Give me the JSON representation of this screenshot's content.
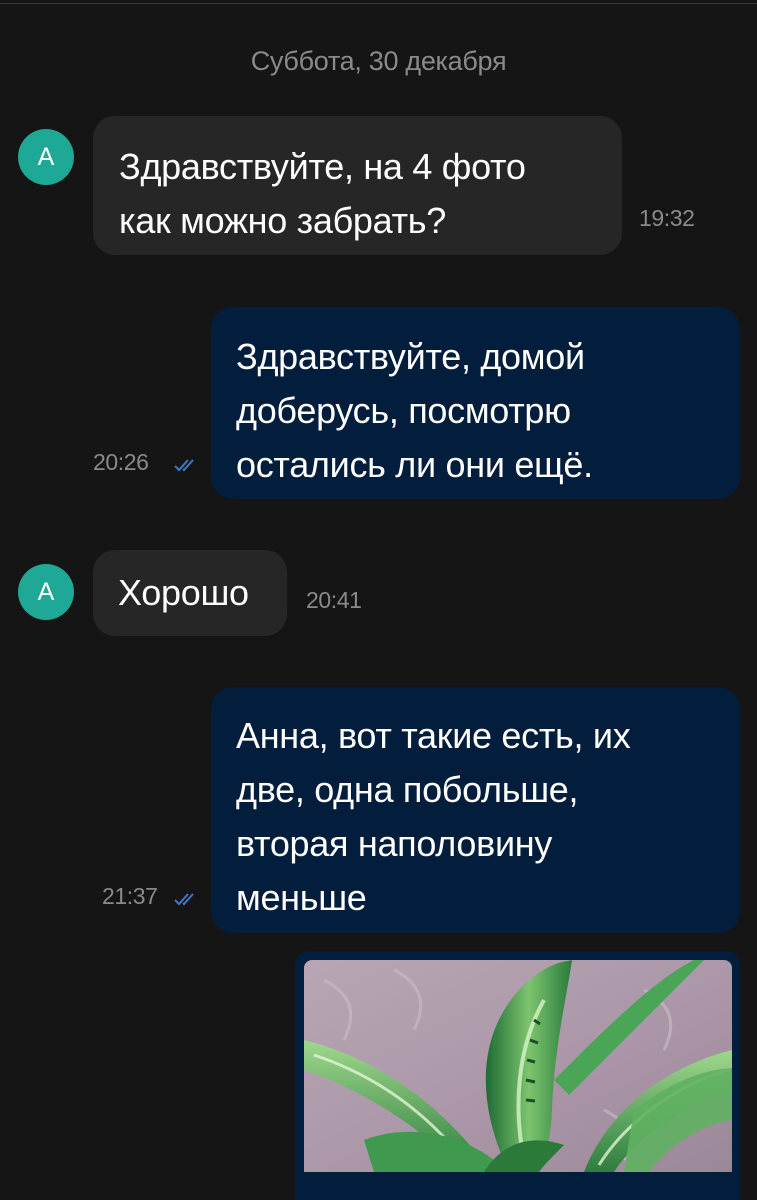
{
  "chat": {
    "date_separator": "Суббота, 30 декабря",
    "messages": [
      {
        "direction": "incoming",
        "avatar_letter": "А",
        "lines": [
          "Здравствуйте, на 4 фото",
          "как можно забрать?"
        ],
        "time": "19:32"
      },
      {
        "direction": "outgoing",
        "lines": [
          "Здравствуйте, домой",
          "доберусь, посмотрю",
          "остались ли они ещё."
        ],
        "time": "20:26",
        "status_icon": "double-check-icon"
      },
      {
        "direction": "incoming",
        "avatar_letter": "А",
        "lines": [
          "Хорошо"
        ],
        "time": "20:41"
      },
      {
        "direction": "outgoing",
        "lines": [
          "Анна, вот такие есть, их",
          "две, одна побольше,",
          "вторая наполовину",
          "меньше"
        ],
        "time": "21:37",
        "status_icon": "double-check-icon"
      },
      {
        "direction": "outgoing",
        "type": "photo",
        "photo_subject": "plant-photo"
      }
    ]
  },
  "colors": {
    "background": "#151515",
    "incoming_bubble": "#262626",
    "outgoing_bubble": "#031d3d",
    "avatar": "#1ea896",
    "timestamp": "#8a8a8a",
    "read_check": "#3f78c4"
  }
}
